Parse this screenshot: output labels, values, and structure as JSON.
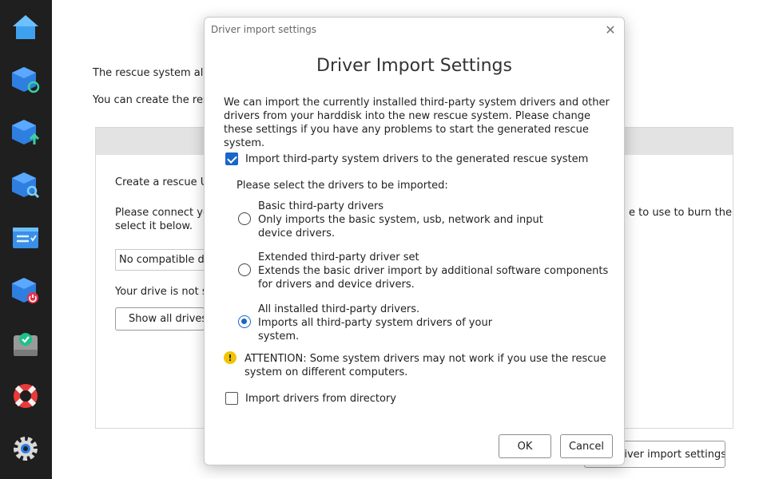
{
  "sidebar": {
    "items": [
      {
        "name": "home-icon"
      },
      {
        "name": "backup-refresh-icon"
      },
      {
        "name": "upload-backup-icon"
      },
      {
        "name": "search-backup-icon"
      },
      {
        "name": "task-list-icon"
      },
      {
        "name": "power-backup-icon"
      },
      {
        "name": "drive-check-icon"
      },
      {
        "name": "rescue-lifebuoy-icon"
      },
      {
        "name": "settings-gear-icon"
      }
    ]
  },
  "background": {
    "line1": "The rescue system allow",
    "line2": "You can create the rescu",
    "create_text": "Create a rescue US",
    "connect_line1": "Please connect you",
    "connect_line2": "select it below.",
    "connect_right": "e to use to burn the",
    "select_value": "No compatible dri",
    "not_shown": "Your drive is not sh",
    "show_all_button": "Show all drives",
    "driver_import_button": "river import settings"
  },
  "dialog": {
    "window_title": "Driver import settings",
    "heading": "Driver Import Settings",
    "intro": "We can import the currently installed third-party system drivers and other drivers from your harddisk into the new rescue system. Please change these settings if you have any problems to start the generated rescue system.",
    "import_checkbox_label": "Import third-party system drivers to the generated rescue system",
    "select_prompt": "Please select the drivers to be imported:",
    "options": [
      {
        "title": "Basic third-party drivers",
        "line1": "Only imports the basic system, usb, network and input",
        "line2": "device drivers.",
        "selected": false
      },
      {
        "title": "Extended third-party driver set",
        "line1": "Extends the basic driver import by additional software components",
        "line2": "for drivers and device drivers.",
        "selected": false
      },
      {
        "title": "All installed third-party drivers.",
        "line1": "Imports all third-party system drivers of your",
        "line2": "system.",
        "selected": true
      }
    ],
    "warning": "ATTENTION: Some system drivers may not work if you use the rescue system on different computers.",
    "directory_checkbox_label": "Import drivers from directory",
    "ok_label": "OK",
    "cancel_label": "Cancel"
  },
  "colors": {
    "accent": "#1a66c8",
    "sidebar_bg": "#1f1f1f",
    "warning": "#f2c400"
  }
}
